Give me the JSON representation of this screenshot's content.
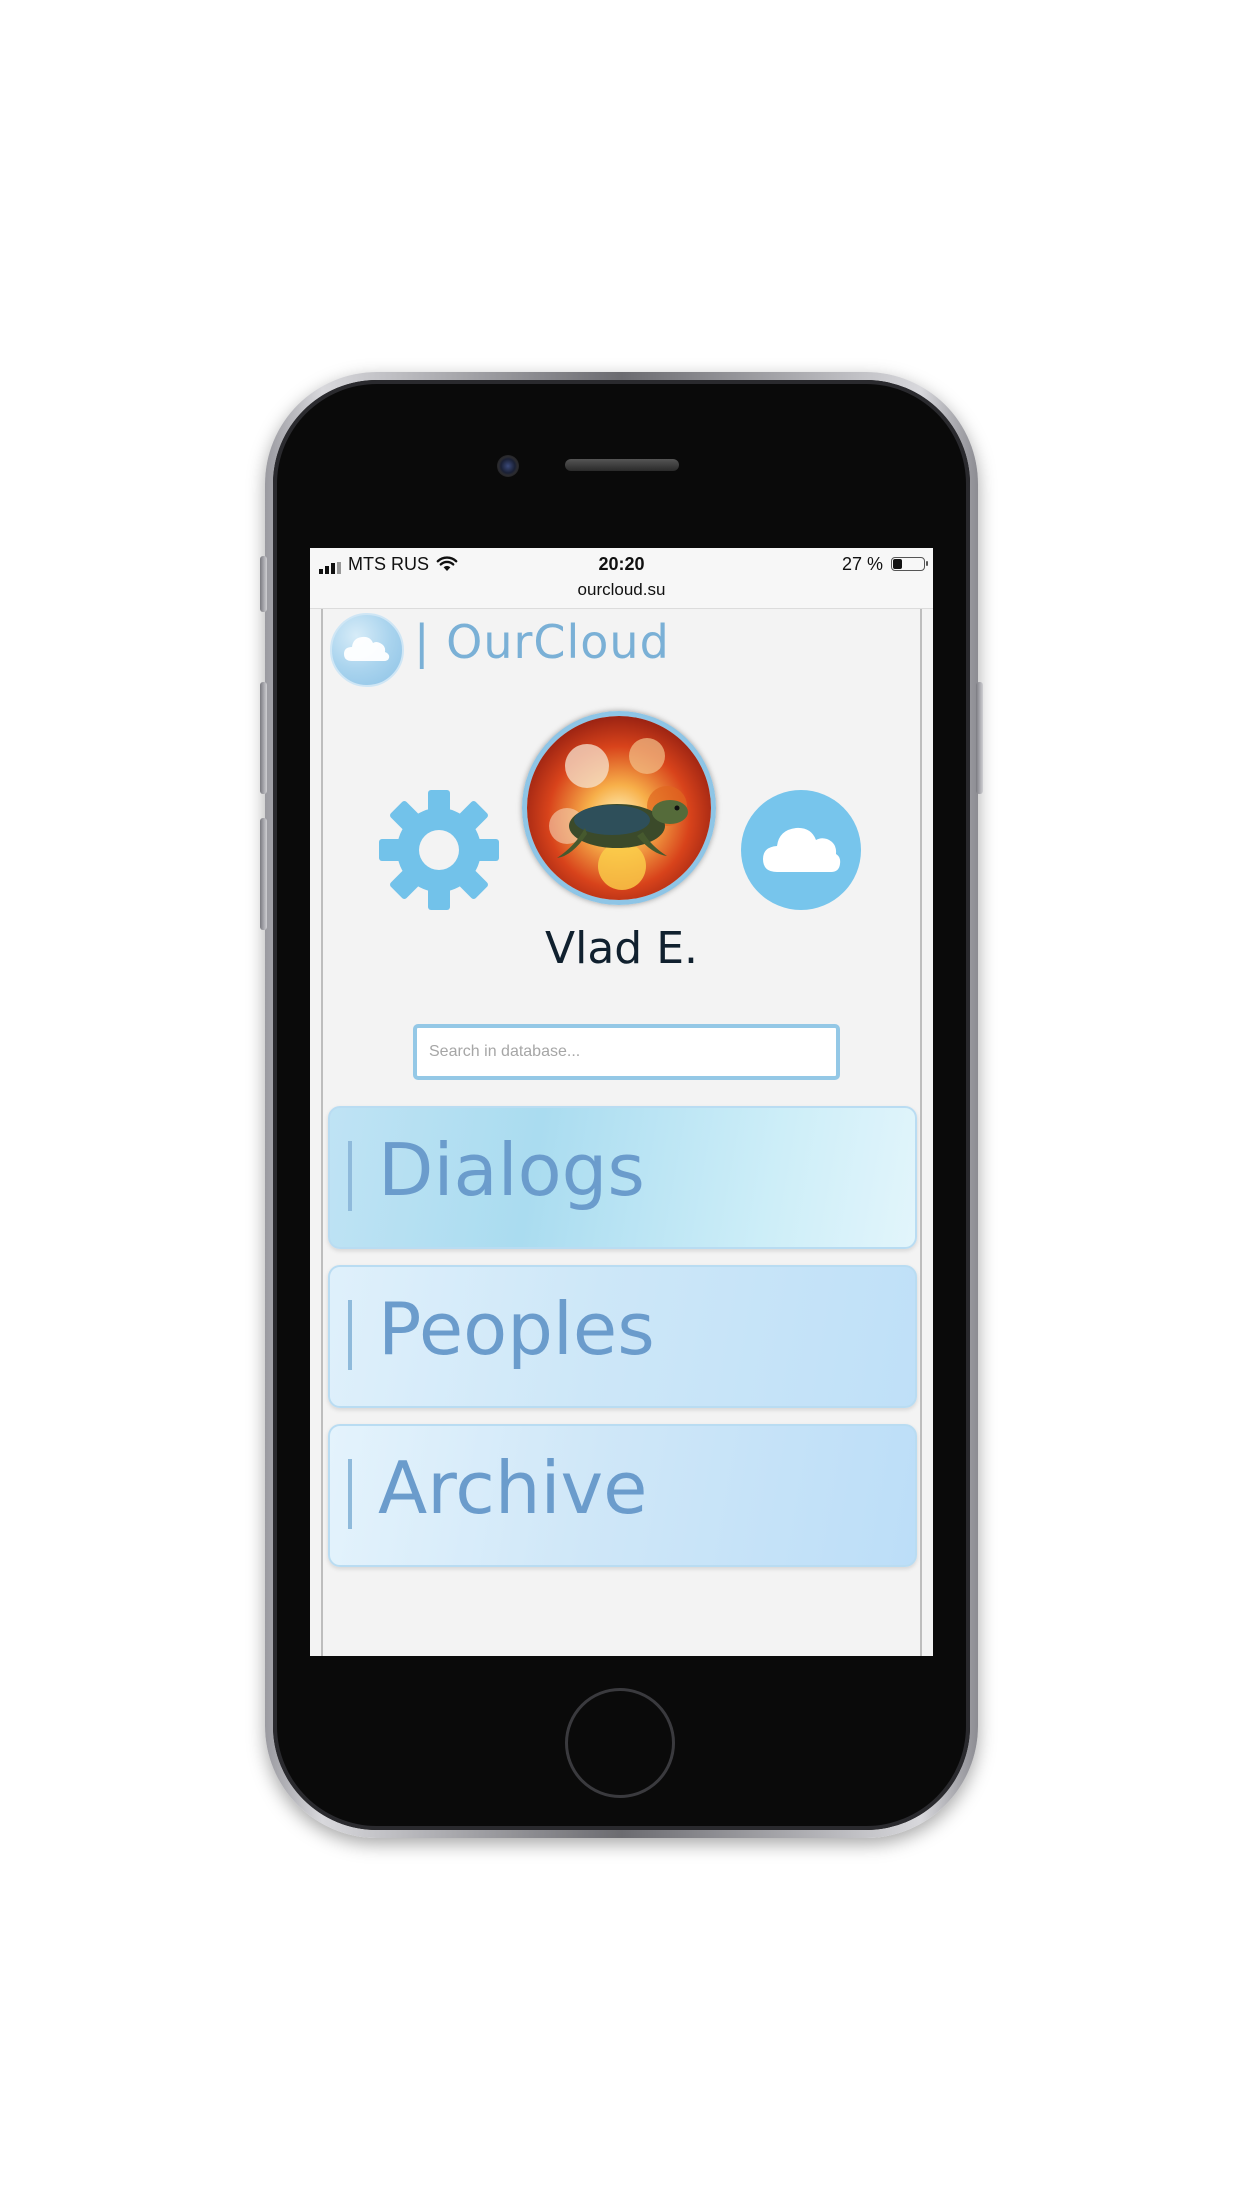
{
  "status_bar": {
    "carrier": "MTS RUS",
    "time": "20:20",
    "battery_percent": "27 %",
    "battery_level": 0.27,
    "url": "ourcloud.su"
  },
  "header": {
    "brand": "| OurCloud",
    "logo_icon": "cloud-icon"
  },
  "profile": {
    "name": "Vlad E.",
    "settings_icon": "gear-icon",
    "cloud_icon": "cloud-icon",
    "avatar": "turtle-explosion-avatar"
  },
  "search": {
    "placeholder": "Search in database...",
    "value": ""
  },
  "menu": {
    "items": [
      {
        "label": "Dialogs"
      },
      {
        "label": "Peoples"
      },
      {
        "label": "Archive"
      }
    ]
  },
  "colors": {
    "accent": "#77c5ec",
    "brand_text": "#7ab0d6",
    "tile_text": "#6b9ccc",
    "background": "#f3f3f3"
  }
}
